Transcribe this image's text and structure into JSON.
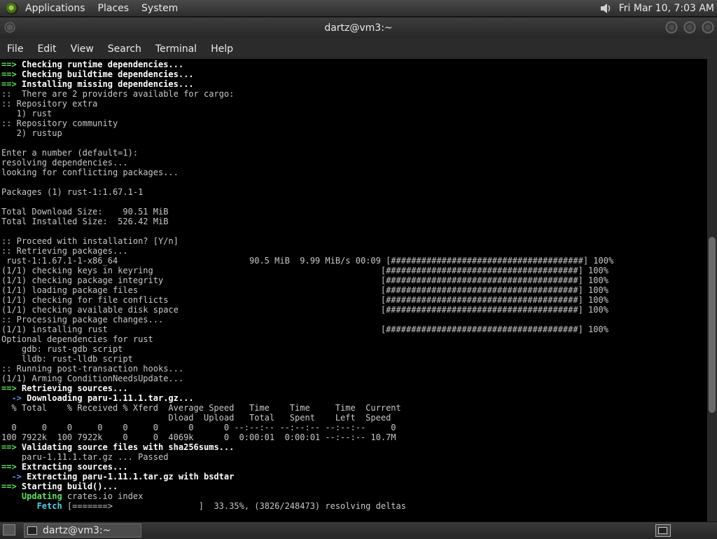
{
  "top_panel": {
    "menus": [
      "Applications",
      "Places",
      "System"
    ],
    "clock": "Fri Mar 10,  7:03 AM"
  },
  "window": {
    "title": "dartz@vm3:~",
    "menu": [
      "File",
      "Edit",
      "View",
      "Search",
      "Terminal",
      "Help"
    ]
  },
  "terminal": {
    "lines": [
      [
        [
          "arrow",
          "==> "
        ],
        [
          "bold",
          "Checking runtime dependencies..."
        ]
      ],
      [
        [
          "arrow",
          "==> "
        ],
        [
          "bold",
          "Checking buildtime dependencies..."
        ]
      ],
      [
        [
          "arrow",
          "==> "
        ],
        [
          "bold",
          "Installing missing dependencies..."
        ]
      ],
      [
        [
          "",
          "::  There are 2 providers available for cargo:"
        ]
      ],
      [
        [
          "",
          ":: Repository extra"
        ]
      ],
      [
        [
          "",
          "   1) rust"
        ]
      ],
      [
        [
          "",
          ":: Repository community"
        ]
      ],
      [
        [
          "",
          "   2) rustup"
        ]
      ],
      [
        [
          "",
          ""
        ]
      ],
      [
        [
          "",
          "Enter a number (default=1):"
        ]
      ],
      [
        [
          "",
          "resolving dependencies..."
        ]
      ],
      [
        [
          "",
          "looking for conflicting packages..."
        ]
      ],
      [
        [
          "",
          ""
        ]
      ],
      [
        [
          "",
          "Packages (1) rust-1:1.67.1-1"
        ]
      ],
      [
        [
          "",
          ""
        ]
      ],
      [
        [
          "",
          "Total Download Size:    90.51 MiB"
        ]
      ],
      [
        [
          "",
          "Total Installed Size:  526.42 MiB"
        ]
      ],
      [
        [
          "",
          ""
        ]
      ],
      [
        [
          "",
          ":: Proceed with installation? [Y/n]"
        ]
      ],
      [
        [
          "",
          ":: Retrieving packages..."
        ]
      ],
      [
        [
          "",
          " rust-1:1.67.1-1-x86_64                          90.5 MiB  9.99 MiB/s 00:09 [######################################] 100%"
        ]
      ],
      [
        [
          "",
          "(1/1) checking keys in keyring                                             [######################################] 100%"
        ]
      ],
      [
        [
          "",
          "(1/1) checking package integrity                                           [######################################] 100%"
        ]
      ],
      [
        [
          "",
          "(1/1) loading package files                                                [######################################] 100%"
        ]
      ],
      [
        [
          "",
          "(1/1) checking for file conflicts                                          [######################################] 100%"
        ]
      ],
      [
        [
          "",
          "(1/1) checking available disk space                                        [######################################] 100%"
        ]
      ],
      [
        [
          "",
          ":: Processing package changes..."
        ]
      ],
      [
        [
          "",
          "(1/1) installing rust                                                      [######################################] 100%"
        ]
      ],
      [
        [
          "",
          "Optional dependencies for rust"
        ]
      ],
      [
        [
          "",
          "    gdb: rust-gdb script"
        ]
      ],
      [
        [
          "",
          "    lldb: rust-lldb script"
        ]
      ],
      [
        [
          "",
          ":: Running post-transaction hooks..."
        ]
      ],
      [
        [
          "",
          "(1/1) Arming ConditionNeedsUpdate..."
        ]
      ],
      [
        [
          "arrow",
          "==> "
        ],
        [
          "bold",
          "Retrieving sources..."
        ]
      ],
      [
        [
          "arrow2",
          "  -> "
        ],
        [
          "bold",
          "Downloading paru-1.11.1.tar.gz..."
        ]
      ],
      [
        [
          "",
          "  % Total    % Received % Xferd  Average Speed   Time    Time     Time  Current"
        ]
      ],
      [
        [
          "",
          "                                 Dload  Upload   Total   Spent    Left  Speed"
        ]
      ],
      [
        [
          "",
          "  0     0    0     0    0     0      0      0 --:--:-- --:--:-- --:--:--     0"
        ]
      ],
      [
        [
          "",
          "100 7922k  100 7922k    0     0  4069k      0  0:00:01  0:00:01 --:--:-- 10.7M"
        ]
      ],
      [
        [
          "arrow",
          "==> "
        ],
        [
          "bold",
          "Validating source files with sha256sums..."
        ]
      ],
      [
        [
          "",
          "    paru-1.11.1.tar.gz ... Passed"
        ]
      ],
      [
        [
          "arrow",
          "==> "
        ],
        [
          "bold",
          "Extracting sources..."
        ]
      ],
      [
        [
          "arrow2",
          "  -> "
        ],
        [
          "bold",
          "Extracting paru-1.11.1.tar.gz with bsdtar"
        ]
      ],
      [
        [
          "arrow",
          "==> "
        ],
        [
          "bold",
          "Starting build()..."
        ]
      ],
      [
        [
          "",
          "    "
        ],
        [
          "green",
          "Updating"
        ],
        [
          "",
          " crates.io index"
        ]
      ],
      [
        [
          "",
          "       "
        ],
        [
          "cyan",
          "Fetch"
        ],
        [
          "",
          " [=======>                 ]  33.35%, (3826/248473) resolving deltas"
        ]
      ]
    ]
  },
  "scrollbar": {
    "position_fraction": 0.62,
    "thumb_fraction": 0.38
  },
  "taskbar": {
    "task_label": "dartz@vm3:~"
  }
}
